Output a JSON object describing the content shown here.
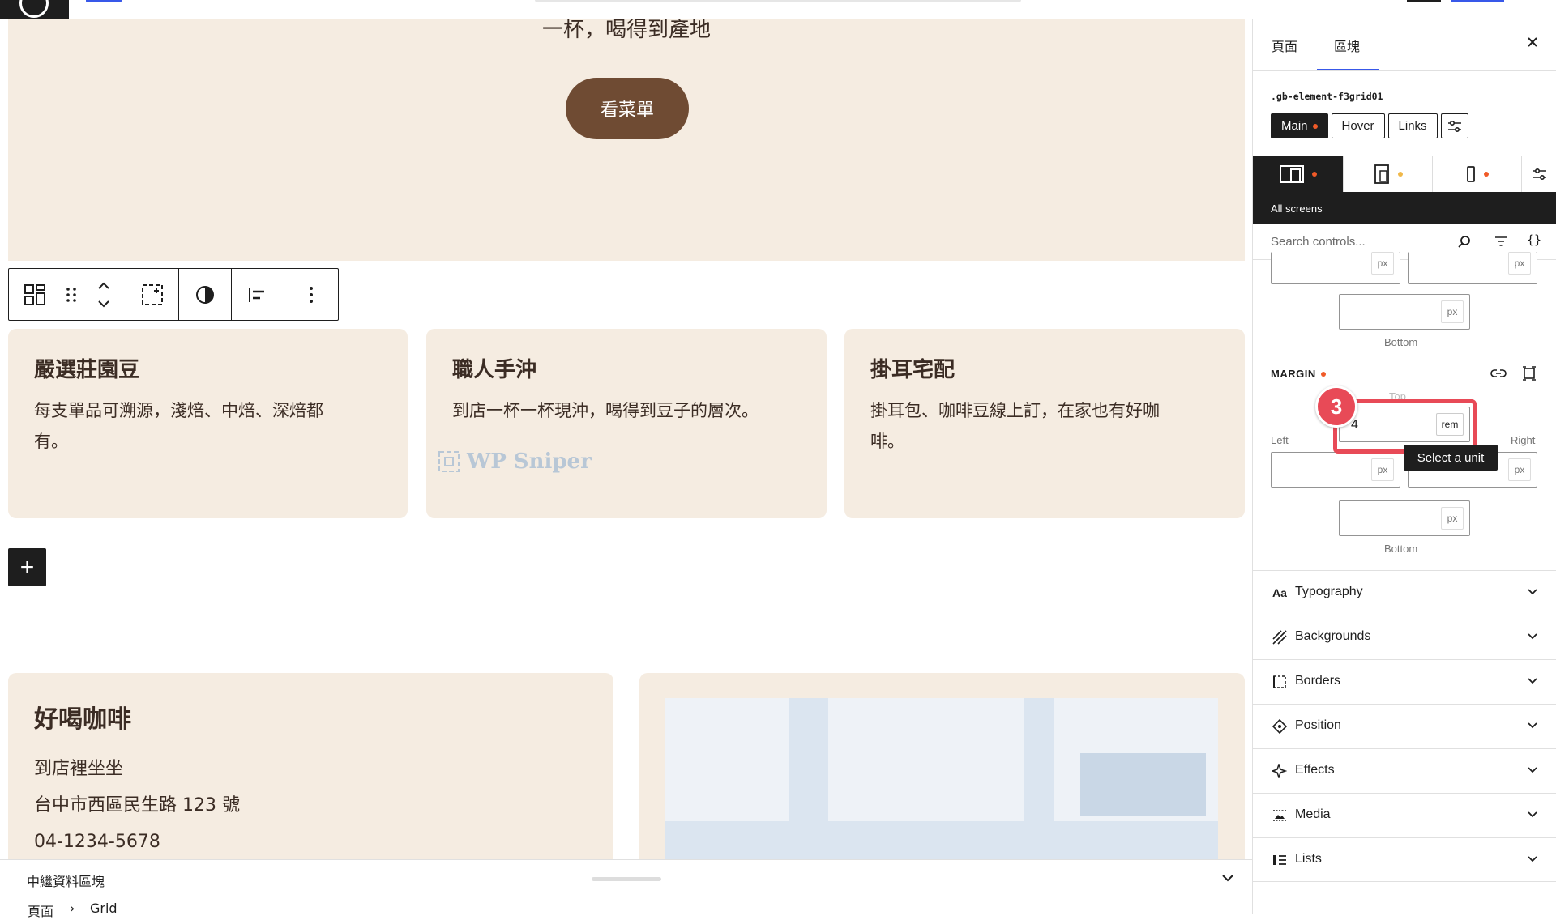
{
  "editor": {
    "hero": {
      "text": "一杯，喝得到產地",
      "button": "看菜單"
    },
    "cards": [
      {
        "title": "嚴選莊園豆",
        "line1": "每支單品可溯源，淺焙、中焙、深焙都",
        "line2": "有。"
      },
      {
        "title": "職人手沖",
        "line1": "到店一杯一杯現沖，喝得到豆子的層次。",
        "line2": ""
      },
      {
        "title": "掛耳宅配",
        "line1": "掛耳包、咖啡豆線上訂，在家也有好咖",
        "line2": "啡。"
      }
    ],
    "watermark": "WP Sniper",
    "add_block": "+",
    "info_card": {
      "title": "好喝咖啡",
      "lines": [
        "到店裡坐坐",
        "台中市西區民生路 123 號",
        "04-1234-5678"
      ]
    }
  },
  "bottom_bar": {
    "label": "中繼資料區塊"
  },
  "breadcrumb": {
    "items": [
      "頁面",
      "Grid"
    ],
    "separator": "›"
  },
  "sidebar": {
    "tabs": [
      {
        "label": "頁面"
      },
      {
        "label": "區塊"
      }
    ],
    "selector": ".gb-element-f3grid01",
    "states": [
      "Main",
      "Hover",
      "Links"
    ],
    "devices_label": "All screens",
    "search": {
      "placeholder": "Search controls..."
    },
    "padding": {
      "unit": "px",
      "bottom_label": "Bottom"
    },
    "margin": {
      "label": "MARGIN",
      "top_label": "Top",
      "top_value": "4",
      "top_unit": "rem",
      "left_label": "Left",
      "right_label": "Right",
      "bottom_label": "Bottom",
      "unit": "px"
    },
    "tooltip": "Select a unit",
    "step_badge": "3",
    "panels": [
      {
        "label": "Typography",
        "icon": "typography-icon"
      },
      {
        "label": "Backgrounds",
        "icon": "backgrounds-icon"
      },
      {
        "label": "Borders",
        "icon": "borders-icon"
      },
      {
        "label": "Position",
        "icon": "position-icon"
      },
      {
        "label": "Effects",
        "icon": "effects-icon"
      },
      {
        "label": "Media",
        "icon": "media-icon"
      },
      {
        "label": "Lists",
        "icon": "lists-icon"
      }
    ]
  },
  "colors": {
    "accent": "#3858e9",
    "card_bg": "#f5ece1",
    "button_brown": "#6f4b33",
    "highlight": "#e84a57",
    "modified_dot": "#f05a28"
  }
}
